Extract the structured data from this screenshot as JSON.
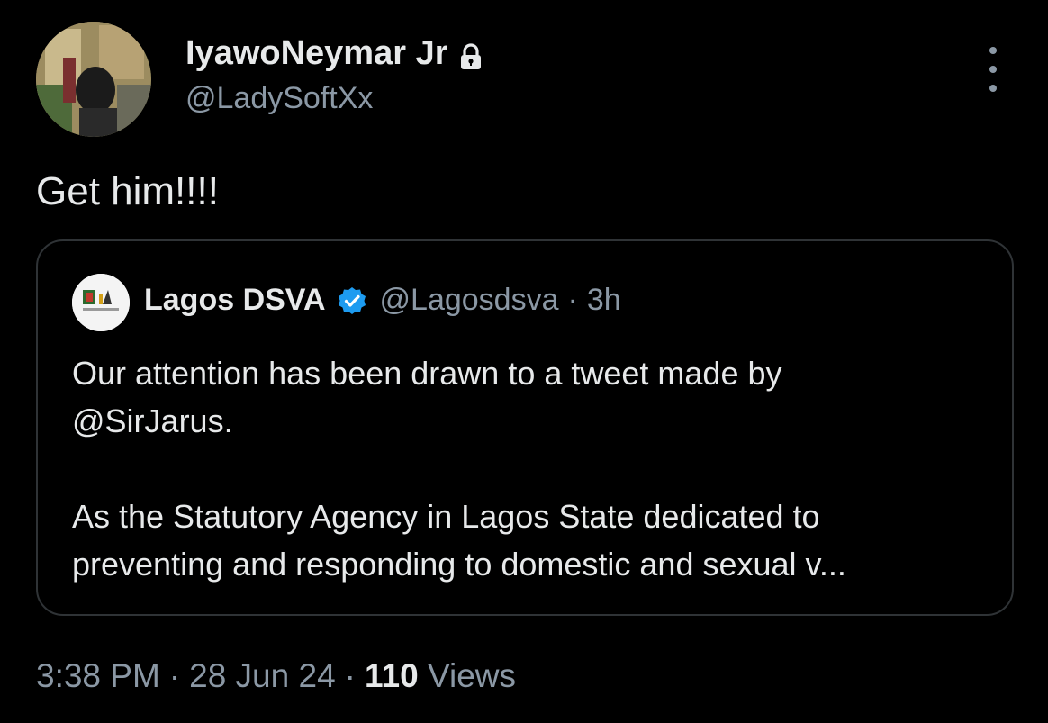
{
  "author": {
    "display_name": "IyawoNeymar Jr",
    "handle": "@LadySoftXx",
    "protected_icon": "lock-icon"
  },
  "tweet": {
    "text": "Get him!!!!"
  },
  "quoted_tweet": {
    "display_name": "Lagos DSVA",
    "handle": "@Lagosdsva",
    "separator": "·",
    "time_ago": "3h",
    "verified_icon": "verified-badge-icon",
    "verified_color": "#1d9bf0",
    "body_line_1": "Our attention has been drawn to a tweet made by",
    "body_line_2": "@SirJarus.",
    "body_line_3": "As the Statutory Agency in Lagos State dedicated to",
    "body_line_4": "preventing and responding to domestic and sexual v..."
  },
  "meta": {
    "time": "3:38 PM",
    "date": "28 Jun 24",
    "separator": "·",
    "views_count": "110",
    "views_label": "Views"
  },
  "colors": {
    "background": "#000000",
    "primary_text": "#e7e9ea",
    "secondary_text": "#8b98a5",
    "border": "#2f3336"
  }
}
